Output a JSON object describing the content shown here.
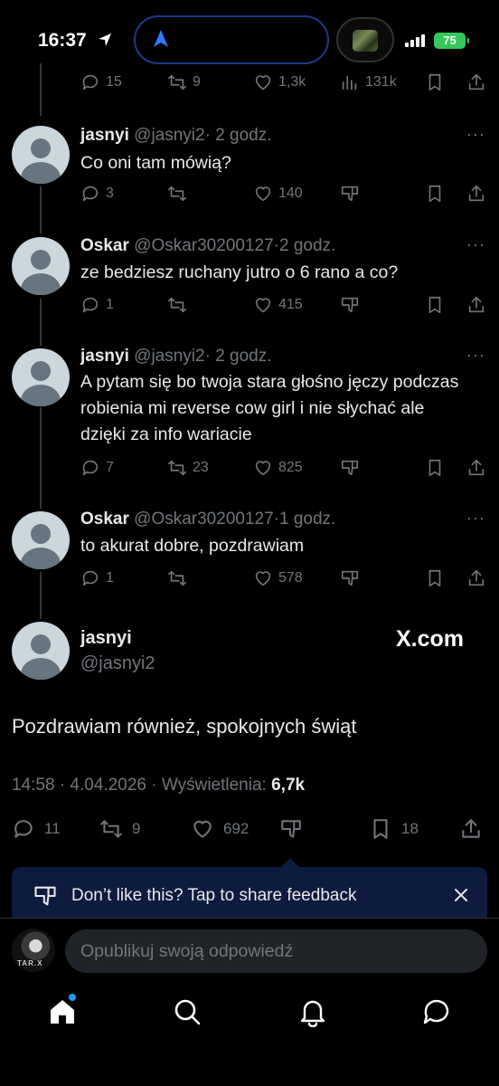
{
  "status_bar": {
    "time": "16:37",
    "battery": "75"
  },
  "top_partial": {
    "replies": "15",
    "retweets": "9",
    "likes": "1,3k",
    "views": "131k"
  },
  "thread": [
    {
      "name": "jasnyi",
      "handle": "@jasnyi2",
      "sep": "·",
      "time": "2 godz.",
      "text": "Co oni tam mówią?",
      "replies": "3",
      "retweets": "",
      "likes": "140"
    },
    {
      "name": "Oskar",
      "handle": "@Oskar30200127",
      "sep": "·",
      "time": "2 godz.",
      "text": "ze bedziesz ruchany jutro o 6 rano a co?",
      "replies": "1",
      "retweets": "",
      "likes": "415"
    },
    {
      "name": "jasnyi",
      "handle": "@jasnyi2",
      "sep": "·",
      "time": "2 godz.",
      "text": "A pytam się bo twoja stara głośno jęczy podczas robienia mi reverse cow girl i nie słychać ale dzięki za info wariacie",
      "replies": "7",
      "retweets": "23",
      "likes": "825"
    },
    {
      "name": "Oskar",
      "handle": "@Oskar30200127",
      "sep": "·",
      "time": "1 godz.",
      "text": "to akurat dobre, pozdrawiam",
      "replies": "1",
      "retweets": "",
      "likes": "578"
    }
  ],
  "main_tweet": {
    "name": "jasnyi",
    "handle": "@jasnyi2",
    "watermark": "X.com",
    "text": "Pozdrawiam również, spokojnych świąt",
    "meta_prefix": "14:58 · 4.04.2026 · Wyświetlenia:",
    "views": "6,7k",
    "replies": "11",
    "retweets": "9",
    "likes": "692",
    "bookmarks": "18"
  },
  "feedback_toast": {
    "text": "Don’t like this? Tap to share feedback"
  },
  "reply": {
    "placeholder": "Opublikuj swoją odpowiedź",
    "avatar_text": "TAR.X"
  },
  "colors": {
    "accent": "#1d9bf0",
    "muted": "#71767b",
    "toast_bg": "#0d1b3e",
    "battery": "#34c759"
  },
  "nav": [
    "home-icon",
    "search-icon",
    "notifications-icon",
    "messages-icon"
  ]
}
